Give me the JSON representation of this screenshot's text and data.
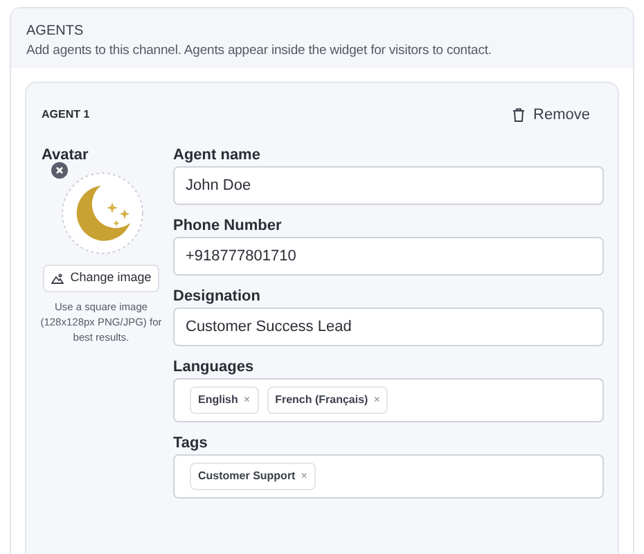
{
  "section": {
    "title": "AGENTS",
    "description": "Add agents to this channel. Agents appear inside the widget for visitors to contact."
  },
  "agents": [
    {
      "title": "AGENT 1",
      "remove_label": "Remove",
      "avatar_label": "Avatar",
      "change_image_label": "Change image",
      "avatar_hint": "Use a square image (128x128px PNG/JPG) for best results.",
      "fields": [
        {
          "kind": "text",
          "label": "Agent name",
          "value": "John Doe"
        },
        {
          "kind": "text",
          "label": "Phone Number",
          "value": "+918777801710"
        },
        {
          "kind": "text",
          "label": "Designation",
          "value": "Customer Success Lead"
        },
        {
          "kind": "tags",
          "label": "Languages",
          "chips": [
            {
              "text": "English",
              "remove": "×"
            },
            {
              "text": "French (Français)",
              "remove": "×"
            }
          ]
        },
        {
          "kind": "tags",
          "label": "Tags",
          "chips": [
            {
              "text": "Customer Support",
              "remove": "×"
            }
          ]
        }
      ]
    }
  ]
}
